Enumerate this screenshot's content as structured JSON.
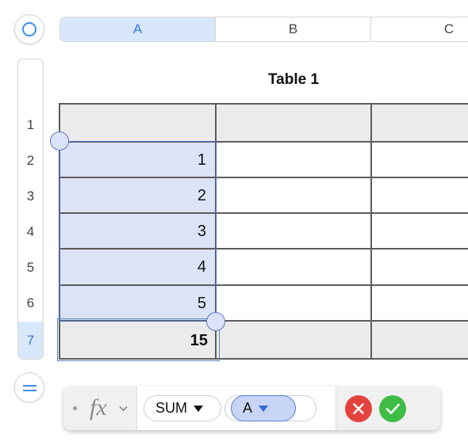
{
  "columns": [
    {
      "label": "A",
      "selected": true
    },
    {
      "label": "B",
      "selected": false
    },
    {
      "label": "C",
      "selected": false
    }
  ],
  "rows": [
    {
      "label": "1",
      "selected": false
    },
    {
      "label": "2",
      "selected": false
    },
    {
      "label": "3",
      "selected": false
    },
    {
      "label": "4",
      "selected": false
    },
    {
      "label": "5",
      "selected": false
    },
    {
      "label": "6",
      "selected": false
    },
    {
      "label": "7",
      "selected": true
    }
  ],
  "table": {
    "title": "Table 1",
    "values": [
      "1",
      "2",
      "3",
      "4",
      "5"
    ],
    "total": "15"
  },
  "formula": {
    "fx_label": "fx",
    "function_name": "SUM",
    "argument": "A"
  },
  "colors": {
    "accent": "#3d8ee8",
    "selection_fill": "#dce3f6",
    "header_fill": "#ebebeb",
    "cancel": "#e3423d",
    "accept": "#3fbc46"
  },
  "icons": {
    "select_all": "circle-icon",
    "add_row": "equals-icon",
    "cancel": "x-icon",
    "accept": "checkmark-icon"
  }
}
